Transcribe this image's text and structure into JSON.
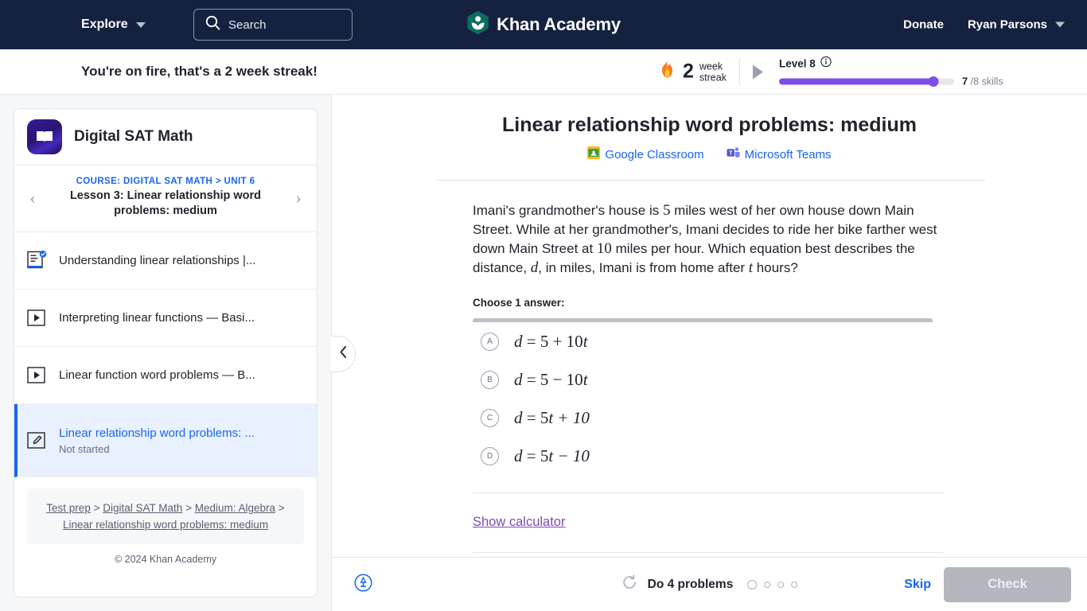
{
  "topnav": {
    "explore_label": "Explore",
    "search_placeholder": "Search",
    "brand_name": "Khan Academy",
    "donate_label": "Donate",
    "user_name": "Ryan Parsons"
  },
  "streakbar": {
    "message": "You're on fire, that's a 2 week streak!",
    "flame_icon": "fire-icon",
    "streak_count": "2",
    "streak_word_1": "week",
    "streak_word_2": "streak",
    "level_label": "Level 8",
    "progress_percent": 88,
    "skills_done": "7",
    "skills_total": "/8 skills"
  },
  "sidebar": {
    "course_title": "Digital SAT Math",
    "course_icon": "book-icon",
    "breadcrumb_course": "COURSE: DIGITAL SAT MATH > UNIT 6",
    "lesson_title": "Lesson 3: Linear relationship word problems: medium",
    "prev_arrow": "‹",
    "next_arrow": "›",
    "items": [
      {
        "label": "Understanding linear relationships |...",
        "icon": "article-complete-icon",
        "status": "",
        "active": false
      },
      {
        "label": "Interpreting linear functions — Basi...",
        "icon": "video-icon",
        "status": "",
        "active": false
      },
      {
        "label": "Linear function word problems — B...",
        "icon": "video-icon",
        "status": "",
        "active": false
      },
      {
        "label": "Linear relationship word problems: ...",
        "icon": "exercise-icon",
        "status": "Not started",
        "active": true
      }
    ],
    "crumbs": [
      {
        "label": "Test prep",
        "link": true
      },
      {
        "label": ">",
        "link": false
      },
      {
        "label": "Digital SAT Math",
        "link": true
      },
      {
        "label": ">",
        "link": false
      },
      {
        "label": "Medium: Algebra",
        "link": true
      },
      {
        "label": ">",
        "link": false
      },
      {
        "label": "Linear relationship word problems: medium",
        "link": true
      }
    ],
    "copyright": "© 2024 Khan Academy"
  },
  "exercise": {
    "title": "Linear relationship word problems: medium",
    "share_links": [
      {
        "label": "Google Classroom",
        "icon": "google-classroom-icon"
      },
      {
        "label": "Microsoft Teams",
        "icon": "microsoft-teams-icon"
      }
    ],
    "collapse_icon": "chevron-left-icon",
    "question": {
      "part1": "Imani's grandmother's house is ",
      "num1": "5",
      "part2": " miles west of her own house down Main Street. While at her grandmother's, Imani decides to ride her bike farther west down Main Street at ",
      "num2": "10",
      "part3": " miles per hour. Which equation best describes the distance, ",
      "var1": "d",
      "part4": ", in miles, Imani is from home after ",
      "var2": "t",
      "part5": " hours?"
    },
    "choose_label": "Choose 1 answer:",
    "choices": [
      {
        "letter": "A",
        "lhs": "d",
        "eq": " = 5 + 10",
        "rhs": "t"
      },
      {
        "letter": "B",
        "lhs": "d",
        "eq": " = 5 − 10",
        "rhs": "t"
      },
      {
        "letter": "C",
        "lhs": "d",
        "eq": " = 5",
        "rhs": "t + 10"
      },
      {
        "letter": "D",
        "lhs": "d",
        "eq": " = 5",
        "rhs": "t − 10"
      }
    ],
    "calculator_label": "Show calculator"
  },
  "bottombar": {
    "report_icon": "report-problem-icon",
    "refresh_icon": "refresh-icon",
    "do_label": "Do 4 problems",
    "dots": [
      "current",
      "pending",
      "pending",
      "pending"
    ],
    "skip_label": "Skip",
    "check_label": "Check"
  },
  "colors": {
    "nav_bg": "#15223f",
    "brand_green": "#14bf96",
    "link_blue": "#1865f2",
    "progress_purple": "#7d4fe8",
    "calculator_purple": "#7b4bb0",
    "disabled_gray": "#b3b6bd"
  }
}
